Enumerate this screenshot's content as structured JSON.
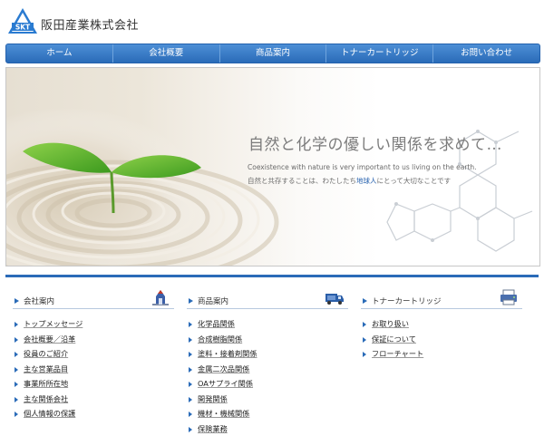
{
  "header": {
    "logo_text": "SKT",
    "company_name": "阪田産業株式会社"
  },
  "nav": [
    "ホーム",
    "会社概要",
    "商品案内",
    "トナーカートリッジ",
    "お問い合わせ"
  ],
  "hero": {
    "title": "自然と化学の優しい関係を求めて…",
    "subtitle_en": "Coexistence with nature is very important to us living on the earth.",
    "subtitle_ja_pre": "自然と共存することは、わたしたち",
    "subtitle_ja_highlight": "地球人",
    "subtitle_ja_post": "にとって大切なことです"
  },
  "columns": [
    {
      "title": "会社案内",
      "icon": "building-icon",
      "items": [
        "トップメッセージ",
        "会社概要／沿革",
        "役員のご紹介",
        "主な営業品目",
        "事業所所在地",
        "主な関係会社",
        "個人情報の保護"
      ]
    },
    {
      "title": "商品案内",
      "icon": "truck-icon",
      "items": [
        "化学品関係",
        "合成樹脂関係",
        "塗料・接着剤関係",
        "金属二次品関係",
        "OAサプライ関係",
        "開発関係",
        "機材・機械関係",
        "保険業務"
      ]
    },
    {
      "title": "トナーカートリッジ",
      "icon": "printer-icon",
      "items": [
        "お取り扱い",
        "保証について",
        "フローチャート"
      ]
    }
  ],
  "colors": {
    "accent": "#2a6bb8",
    "nav_top": "#4d8fd6",
    "highlight": "#2a64b0"
  }
}
